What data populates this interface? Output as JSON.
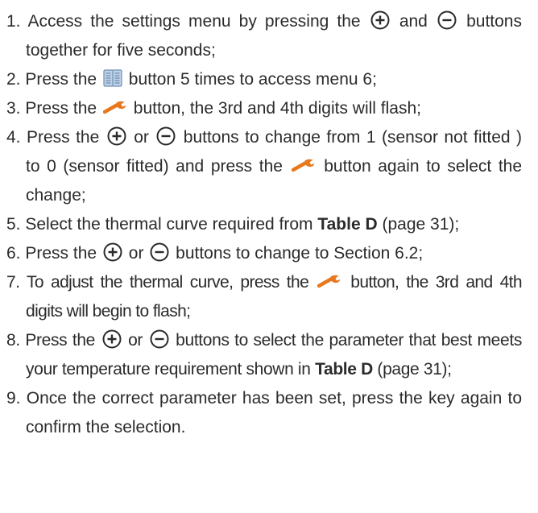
{
  "steps": [
    {
      "number": "1.",
      "parts": [
        "Access the settings menu by pressing the",
        "and",
        "buttons together for five seconds;"
      ]
    },
    {
      "number": "2.",
      "parts": [
        "Press the",
        "button 5 times to access menu 6;"
      ]
    },
    {
      "number": "3.",
      "parts": [
        "Press the",
        "button, the 3rd and 4th digits will flash;"
      ]
    },
    {
      "number": "4.",
      "parts": [
        "Press the",
        "or",
        "buttons to change from 1 (sensor not fitted ) to 0 (sensor fitted) and press the",
        "button again to select the change;"
      ]
    },
    {
      "number": "5.",
      "parts": [
        "Select the thermal curve required from",
        "Table D",
        "(page 31);"
      ]
    },
    {
      "number": "6.",
      "parts": [
        "Press the",
        "or",
        "buttons to change to Section 6.2;"
      ]
    },
    {
      "number": "7.",
      "parts": [
        "To adjust the thermal curve, press the",
        "button, the 3rd and 4th digits will begin to flash;"
      ]
    },
    {
      "number": "8.",
      "parts": [
        "Press the",
        "or",
        "buttons to select the parameter that best meets your temperature requirement shown in",
        "Table D",
        "(page 31);"
      ]
    },
    {
      "number": "9.",
      "parts": [
        "Once the correct parameter has been set, press the key again to confirm the selection."
      ]
    }
  ],
  "icons": {
    "plus": "plus-button-icon",
    "minus": "minus-button-icon",
    "menu": "menu-book-icon",
    "wrench": "wrench-icon"
  },
  "colors": {
    "text": "#2b2b2b",
    "wrench": "#e8781e",
    "menu_icon": "#8fb0d2"
  }
}
